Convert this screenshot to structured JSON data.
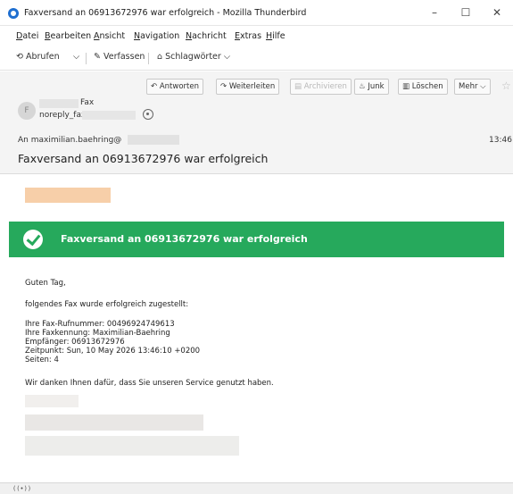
{
  "window": {
    "title": "Faxversand an 06913672976 war erfolgreich - Mozilla Thunderbird",
    "minimize": "–",
    "maximize": "☐",
    "close": "✕"
  },
  "menu": [
    "Datei",
    "Bearbeiten",
    "Ansicht",
    "Navigation",
    "Nachricht",
    "Extras",
    "Hilfe"
  ],
  "toolbar": {
    "fetch": "Abrufen",
    "compose": "Verfassen",
    "tags": "Schlagwörter"
  },
  "header_actions": {
    "reply": "Antworten",
    "forward": "Weiterleiten",
    "archive": "Archivieren",
    "junk": "Junk",
    "delete": "Löschen",
    "more": "Mehr"
  },
  "message": {
    "from_name": "Fax",
    "from_email": "noreply_fax@",
    "to_label": "An",
    "to_value": "maximilian.baehring@",
    "time": "13:46",
    "subject": "Faxversand an 06913672976 war erfolgreich"
  },
  "body": {
    "banner": "Faxversand an 06913672976 war erfolgreich",
    "greeting": "Guten Tag,",
    "intro": "folgendes Fax wurde erfolgreich zugestellt:",
    "fax_number": "Ihre Fax-Rufnummer: 00496924749613",
    "fax_id": "Ihre Faxkennung: Maximilian-Baehring",
    "recipient": "Empfänger: 06913672976",
    "timestamp": "Zeitpunkt: Sun, 10 May 2026 13:46:10 +0200",
    "pages": "Seiten: 4",
    "thanks": "Wir danken Ihnen dafür, dass Sie unseren Service genutzt haben."
  },
  "status": {
    "icon_text": "((•))"
  },
  "colors": {
    "banner_green": "#26a95c",
    "logo_orange": "#f7cfa9",
    "accent_blue": "#1f6fd0"
  }
}
